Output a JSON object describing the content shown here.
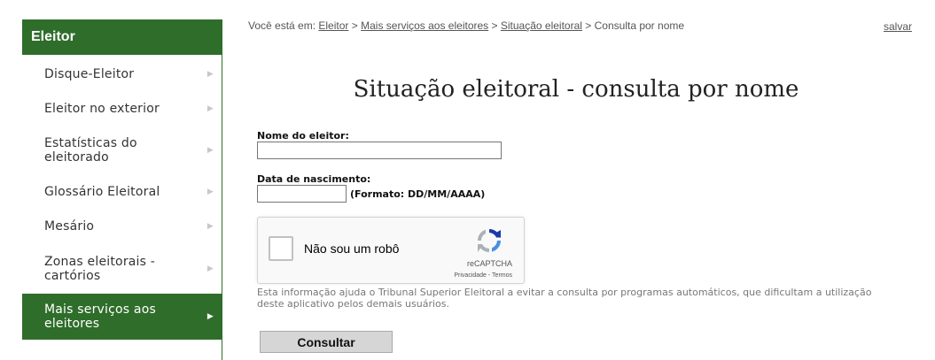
{
  "sidebar": {
    "title": "Eleitor",
    "items": [
      {
        "label": "Disque-Eleitor"
      },
      {
        "label": "Eleitor no exterior"
      },
      {
        "label": "Estatísticas do eleitorado"
      },
      {
        "label": "Glossário Eleitoral"
      },
      {
        "label": "Mesário"
      },
      {
        "label": "Zonas eleitorais - cartórios"
      },
      {
        "label": "Mais serviços aos eleitores",
        "active": true
      }
    ]
  },
  "breadcrumb": {
    "prefix": "Você está em:",
    "links": [
      "Eleitor",
      "Mais serviços aos eleitores",
      "Situação eleitoral"
    ],
    "separator": ">",
    "current": "Consulta por nome"
  },
  "header": {
    "save_label": "salvar"
  },
  "page": {
    "title": "Situação eleitoral - consulta por nome"
  },
  "form": {
    "name_label": "Nome do eleitor:",
    "name_value": "",
    "birth_label": "Data de nascimento:",
    "birth_value": "",
    "birth_format": "(Formato: DD/MM/AAAA)",
    "captcha": {
      "label": "Não sou um robô",
      "brand": "reCAPTCHA",
      "terms": "Privacidade - Termos"
    },
    "captcha_info": "Esta informação ajuda o Tribunal Superior Eleitoral a evitar a consulta por programas automáticos, que dificultam a utilização deste aplicativo pelos demais usuários.",
    "submit_label": "Consultar"
  },
  "colors": {
    "brand_green": "#2f6d2a",
    "captcha_blue": "#4a90e2"
  }
}
